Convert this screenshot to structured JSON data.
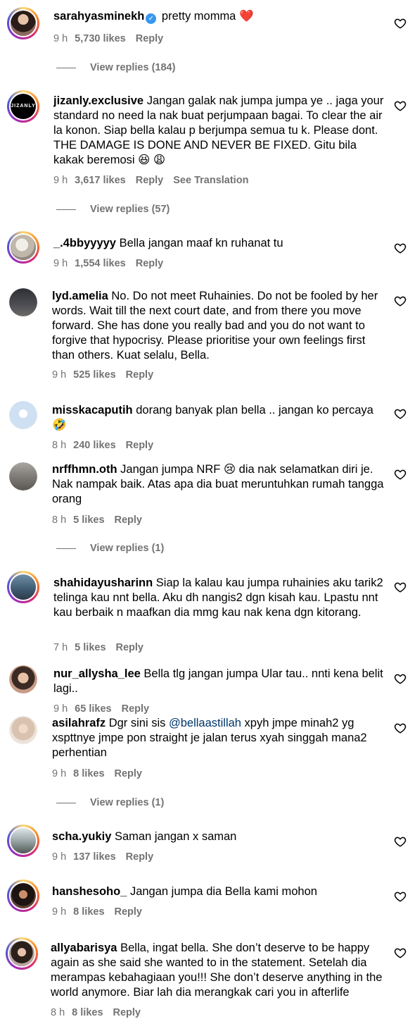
{
  "comments": [
    {
      "username": "sarahyasminekh",
      "verified": true,
      "text": "pretty momma ❤️",
      "time": "9 h",
      "likes": "5,730 likes",
      "reply": "Reply",
      "view_replies": "View replies (184)"
    },
    {
      "username": "jizanly.exclusive",
      "text": "Jangan galak nak jumpa jumpa ye .. jaga your standard no need la nak buat perjumpaan bagai. To clear the air la konon. Siap bella kalau p berjumpa semua tu k. Please dont. THE DAMAGE IS DONE AND NEVER BE FIXED. Gitu bila kakak beremosi 😆 😩",
      "time": "9 h",
      "likes": "3,617 likes",
      "reply": "Reply",
      "see_translation": "See Translation",
      "view_replies": "View replies (57)",
      "avatar_logo": "JIZANLY"
    },
    {
      "username": "_.4bbyyyyy",
      "text": "Bella jangan maaf kn ruhanat tu",
      "time": "9 h",
      "likes": "1,554 likes",
      "reply": "Reply"
    },
    {
      "username": "lyd.amelia",
      "text": "No. Do not meet Ruhainies. Do not be fooled by her words. Wait till the next court date, and from there you move forward. She has done you really bad and you do not want to forgive that hypocrisy. Please prioritise your own feelings first than others. Kuat selalu, Bella.",
      "time": "9 h",
      "likes": "525 likes",
      "reply": "Reply"
    },
    {
      "username": "misskacaputih",
      "text": "dorang banyak plan bella .. jangan ko percaya 🤣",
      "time": "8 h",
      "likes": "240 likes",
      "reply": "Reply"
    },
    {
      "username": "nrffhmn.oth",
      "text": "Jangan jumpa NRF 😢 dia nak selamatkan diri je. Nak nampak baik. Atas apa dia buat meruntuhkan rumah tangga orang",
      "time": "8 h",
      "likes": "5 likes",
      "reply": "Reply",
      "view_replies": "View replies (1)"
    },
    {
      "username": "shahidayusharinn",
      "text": "Siap la kalau kau jumpa ruhainies aku tarik2 telinga kau nnt bella. Aku dh nangis2 dgn kisah kau. Lpastu nnt kau berbaik n maafkan dia mmg kau nak kena dgn kitorang.",
      "time": "7 h",
      "likes": "5 likes",
      "reply": "Reply"
    },
    {
      "username": "nur_allysha_lee",
      "text": "Bella tlg jangan jumpa Ular tau.. nnti kena belit lagi..",
      "time": "9 h",
      "likes": "65 likes",
      "reply": "Reply"
    },
    {
      "username": "asilahrafz",
      "text_before": "Dgr sini sis ",
      "mention": "@bellaastillah",
      "text_after": " xpyh jmpe minah2 yg xspttnye jmpe pon straight je jalan terus xyah singgah mana2 perhentian",
      "time": "9 h",
      "likes": "8 likes",
      "reply": "Reply",
      "view_replies": "View replies (1)"
    },
    {
      "username": "scha.yukiy",
      "text": "Saman jangan x saman",
      "time": "9 h",
      "likes": "137 likes",
      "reply": "Reply"
    },
    {
      "username": "hanshesoho_",
      "text": "Jangan jumpa dia Bella kami mohon",
      "time": "9 h",
      "likes": "8 likes",
      "reply": "Reply"
    },
    {
      "username": "allyabarisya",
      "text": "Bella, ingat bella. She don’t deserve to be happy again as she said she wanted to in the statement. Setelah dia merampas kebahagiaan you!!! She don’t deserve anything in the world anymore. Biar lah dia merangkak cari you in afterlife",
      "time": "8 h",
      "likes": "8 likes",
      "reply": "Reply"
    }
  ],
  "colors": {
    "meta": "#737373",
    "verified": "#3897f0",
    "mention": "#00376b"
  },
  "icons": {
    "like": "heart-outline-icon",
    "verified": "verified-badge-icon"
  }
}
